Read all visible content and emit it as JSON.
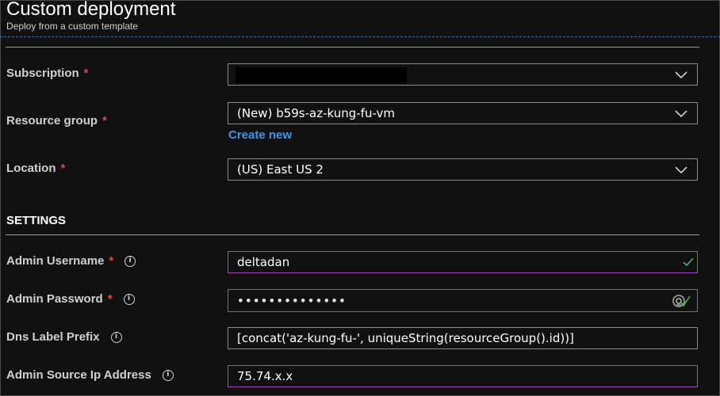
{
  "header": {
    "title": "Custom deployment",
    "subtitle": "Deploy from a custom template"
  },
  "form": {
    "subscription": {
      "label": "Subscription",
      "required_mark": "*",
      "value": ""
    },
    "resource_group": {
      "label": "Resource group",
      "required_mark": "*",
      "value": "(New) b59s-az-kung-fu-vm",
      "create_new": "Create new"
    },
    "location": {
      "label": "Location",
      "required_mark": "*",
      "value": "(US) East US 2"
    }
  },
  "settings": {
    "section_title": "SETTINGS",
    "admin_username": {
      "label": "Admin Username",
      "required_mark": "*",
      "info": "i",
      "value": "deltadan"
    },
    "admin_password": {
      "label": "Admin Password",
      "required_mark": "*",
      "info": "i",
      "value": "••••••••••••••"
    },
    "dns_label_prefix": {
      "label": "Dns Label Prefix",
      "info": "i",
      "value": "[concat('az-kung-fu-', uniqueString(resourceGroup().id))]"
    },
    "admin_source_ip": {
      "label": "Admin Source Ip Address",
      "info": "i",
      "value": "75.74.x.x"
    }
  },
  "colors": {
    "background": "#111111",
    "required": "#e0474c",
    "link": "#3c96e6",
    "valid_border": "#9a4fb3",
    "valid_check": "#5cb85c"
  },
  "icons": {
    "dropdown": "chevron-down-icon",
    "info": "info-icon",
    "valid": "checkmark-icon",
    "password_reveal": "password-reveal-icon"
  }
}
